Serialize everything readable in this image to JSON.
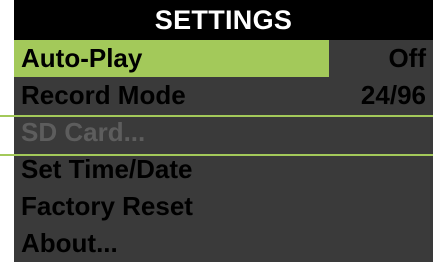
{
  "title": "SETTINGS",
  "colors": {
    "highlight": "#a3c95a",
    "menu_background": "#3a3a3a",
    "title_background": "#000000",
    "disabled_text": "#5d5d5d"
  },
  "menu": {
    "items": [
      {
        "label": "Auto-Play",
        "value": "Off",
        "selected": true
      },
      {
        "label": "Record Mode",
        "value": "24/96"
      },
      {
        "label": "SD Card...",
        "disabled": true
      },
      {
        "label": "Set Time/Date"
      },
      {
        "label": "Factory Reset"
      },
      {
        "label": "About..."
      }
    ]
  }
}
